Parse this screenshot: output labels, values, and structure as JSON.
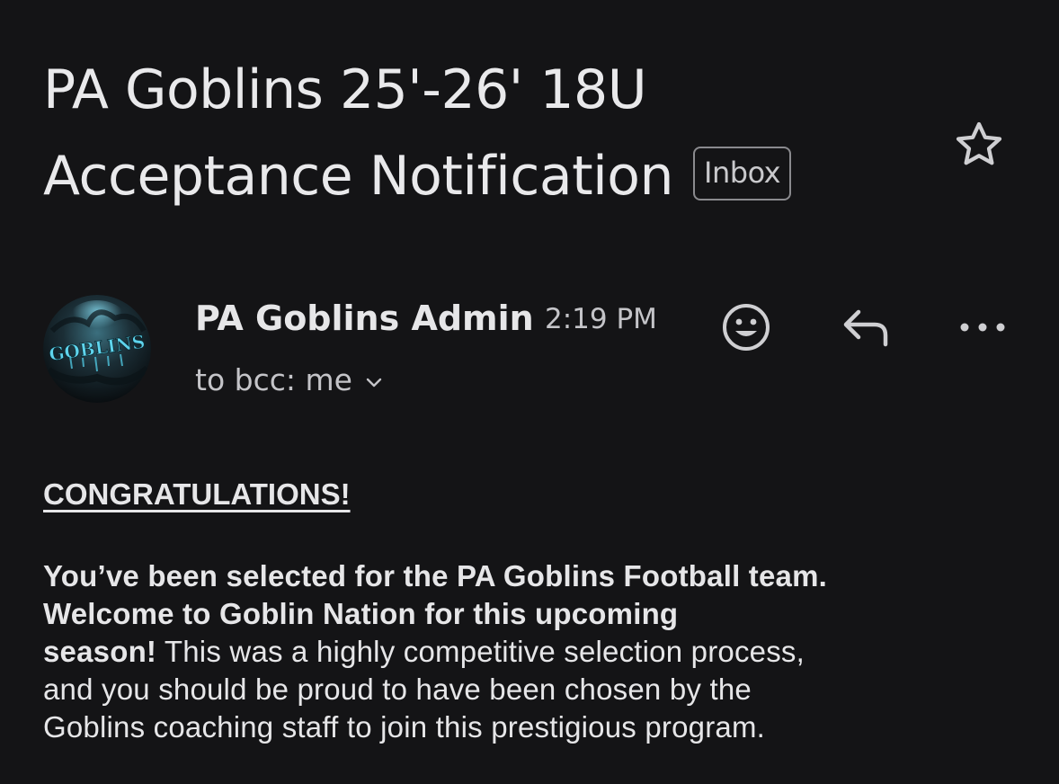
{
  "email": {
    "subject": "PA Goblins 25'-26' 18U Acceptance Notification",
    "label": "Inbox",
    "starred": false,
    "sender": {
      "name": "PA Goblins Admin",
      "avatar_text": "GOBLINS",
      "time": "2:19 PM",
      "recipients": "to bcc: me"
    },
    "actions": {
      "emoji_icon": "smiley-icon",
      "reply_icon": "reply-arrow-icon",
      "more_icon": "more-horizontal-icon"
    },
    "body": {
      "heading": "CONGRATULATIONS!",
      "bold_line_1": "You’ve been selected for the PA Goblins Football team.",
      "bold_line_2": "Welcome to Goblin Nation for this upcoming",
      "bold_line_3": "season!",
      "rest_line_1": " This was a highly competitive selection process,",
      "rest_line_2": "and you should be proud to have been chosen by the",
      "rest_line_3": "Goblins coaching staff to join this prestigious program."
    }
  },
  "colors": {
    "background": "#141416",
    "text": "#e6e6e8",
    "muted": "#c4c4c8",
    "chip_border": "#8a8a8e",
    "avatar_accent": "#4fd0e8"
  }
}
